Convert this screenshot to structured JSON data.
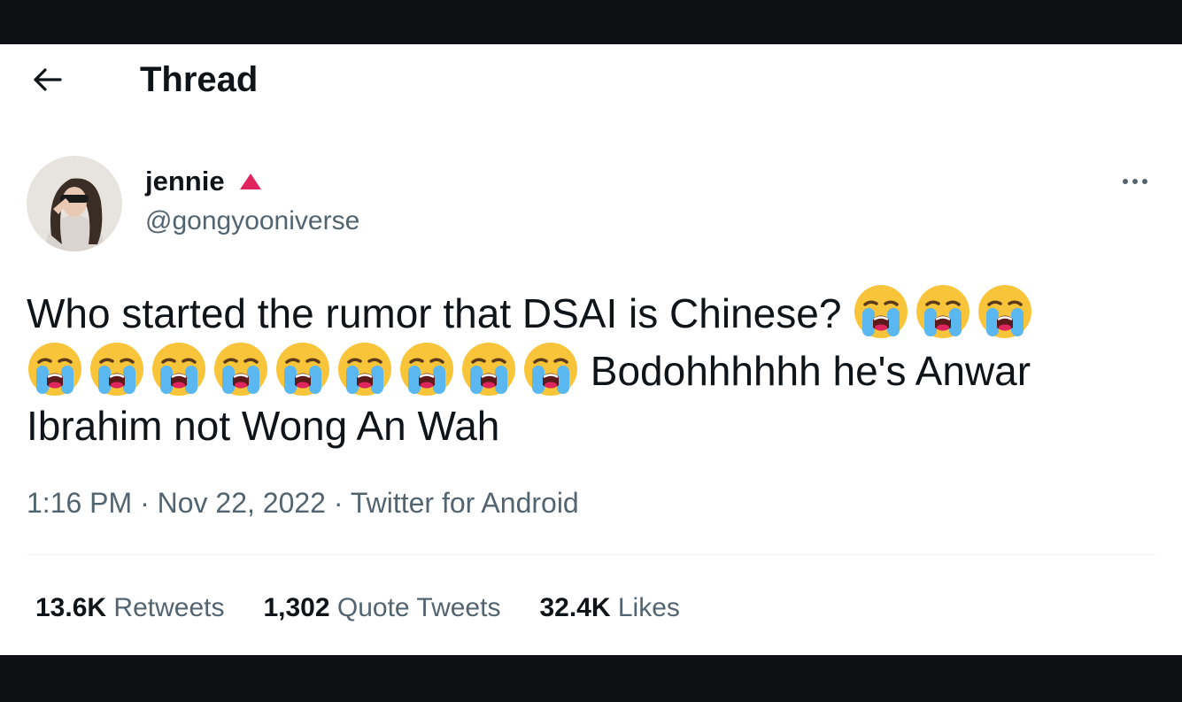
{
  "header": {
    "title": "Thread",
    "back_icon": "arrow-left-icon"
  },
  "tweet": {
    "author": {
      "display_name": "jennie",
      "badge_icon": "red-triangle-icon",
      "badge_color": "#e0245e",
      "handle": "@gongyooniverse"
    },
    "text_parts": {
      "line1": "Who started the rumor that DSAI is Chinese?",
      "line2_tail": "Bodohhhhhh he's Anwar",
      "line3": "Ibrahim not Wong An Wah"
    },
    "emoji": {
      "name": "loudly-crying-face-icon",
      "count_line1": 3,
      "count_line2": 9
    },
    "meta": {
      "time": "1:16 PM",
      "separator": "·",
      "date": "Nov 22, 2022",
      "source": "Twitter for Android"
    },
    "stats": {
      "retweets_count": "13.6K",
      "retweets_label": "Retweets",
      "quotes_count": "1,302",
      "quotes_label": "Quote Tweets",
      "likes_count": "32.4K",
      "likes_label": "Likes"
    }
  },
  "more_icon": "more-horizontal-icon",
  "colors": {
    "text": "#0f1419",
    "secondary": "#536471",
    "divider": "#eff3f4",
    "background": "#ffffff"
  }
}
